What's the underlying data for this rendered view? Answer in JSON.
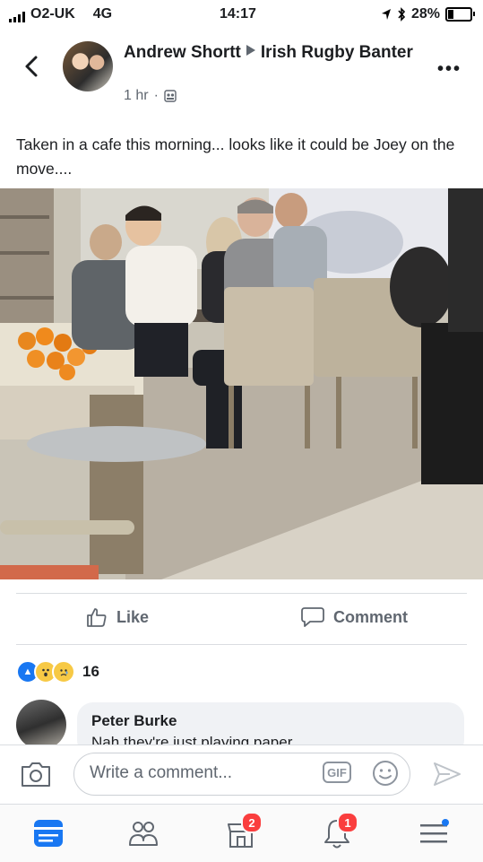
{
  "status_bar": {
    "carrier": "O2-UK",
    "network": "4G",
    "time": "14:17",
    "battery": "28%",
    "battery_level": 0.28
  },
  "post": {
    "author": "Andrew Shortt",
    "group": "Irish Rugby Banter",
    "time": "1 hr",
    "text": "Taken in a cafe this morning... looks like it could be Joey on the move....",
    "photo_icon": "cafe-photo"
  },
  "actions": {
    "like": "Like",
    "comment": "Comment"
  },
  "reactions": {
    "count": "16",
    "types": [
      "like",
      "wow",
      "sad"
    ]
  },
  "comment": {
    "name": "Peter Burke",
    "text": "Nah they're just playing paper"
  },
  "composer": {
    "placeholder": "Write a comment...",
    "gif": "GIF"
  },
  "nav": {
    "marketplace_badge": "2",
    "notifications_badge": "1"
  },
  "colors": {
    "accent": "#1877f2",
    "badge": "#fa3e3e"
  }
}
